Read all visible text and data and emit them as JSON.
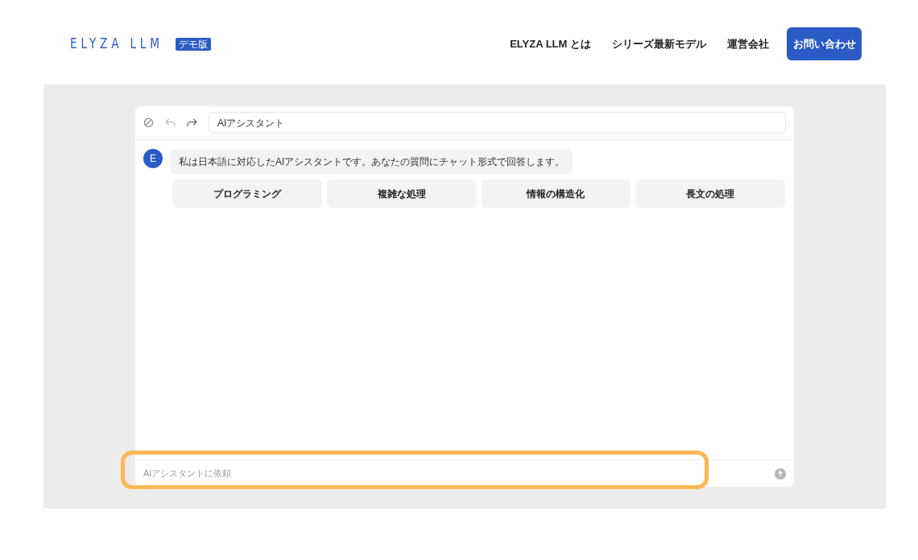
{
  "header": {
    "logo": "ELYZA LLM",
    "logo_badge": "デモ版",
    "nav": [
      "ELYZA LLM とは",
      "シリーズ最新モデル",
      "運営会社"
    ],
    "cta": "お問い合わせ"
  },
  "chat": {
    "title": "AIアシスタント",
    "messages": [
      {
        "avatar": "E",
        "text": "私は日本語に対応したAIアシスタントです。あなたの質問にチャット形式で回答します。"
      }
    ],
    "suggestions": [
      "プログラミング",
      "複雑な処理",
      "情報の構造化",
      "長文の処理"
    ],
    "input": {
      "placeholder": "AIアシスタントに依頼",
      "highlighted": true
    }
  }
}
